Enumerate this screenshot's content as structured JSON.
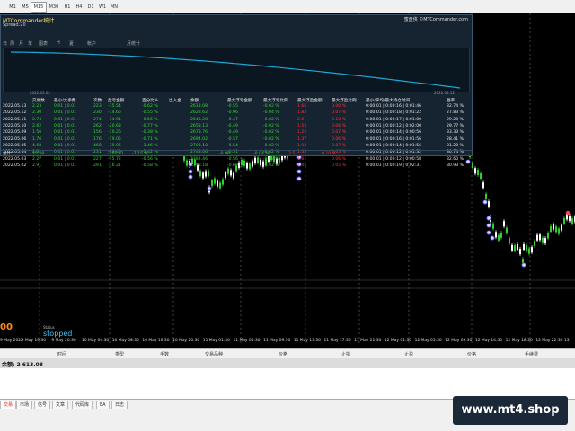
{
  "timeframes": [
    "M1",
    "M5",
    "M15",
    "M30",
    "H1",
    "H4",
    "D1",
    "W1",
    "MN"
  ],
  "active_timeframe": "M30",
  "panel": {
    "title": "MTCommander统计",
    "subtitle": "Spread:20",
    "link": "蜜盘侠 ©MTCommander.com",
    "tabs": [
      "日",
      "周",
      "月",
      "年",
      "图表",
      "H",
      "夏",
      "帐户",
      "",
      "",
      "",
      "月统计",
      "账"
    ],
    "equity_start": "2022.05.02",
    "equity_end": "2022.05.12",
    "headers": [
      "",
      "交易数",
      "最小/大手数",
      "次数",
      "盈亏金额",
      "百分比%",
      "出入金",
      "余额",
      "最大浮亏金额",
      "最大浮亏比例",
      "最大浮盈金额",
      "最大浮盈比例",
      "最小/平均/最大持仓时间",
      "胜率"
    ],
    "rows": [
      [
        "2022.05.13",
        "2.23",
        "0.01 | 0.01",
        "223",
        "-15.54",
        "-0.62 %",
        "",
        "2613.08",
        "-0.55",
        "-0.02 %",
        "1.65",
        "0.00 %",
        "0:00:01 | 0:00:16 | 0:01:46",
        "32.74 %"
      ],
      [
        "2022.05.12",
        "2.30",
        "0.01 | 0.01",
        "230",
        "-14.66",
        "-0.55 %",
        "",
        "2628.62",
        "-0.96",
        "-0.04 %",
        "1.83",
        "0.07 %",
        "0:00:01 | 0:00:18 | 0:01:22",
        "27.83 %"
      ],
      [
        "2022.05.11",
        "2.74",
        "0.01 | 0.01",
        "274",
        "-14.91",
        "-0.56 %",
        "",
        "2643.28",
        "-0.47",
        "-0.02 %",
        "2.5",
        "0.10 %",
        "0:00:01 | 0:00:17 | 0:01:00",
        "29.20 %"
      ],
      [
        "2022.05.10",
        "2.62",
        "0.01 | 0.01",
        "262",
        "-20.63",
        "-0.77 %",
        "",
        "2658.13",
        "-0.49",
        "-0.02 %",
        "1.53",
        "0.06 %",
        "0:00:01 | 0:00:12 | 0:02:00",
        "29.77 %"
      ],
      [
        "2022.05.09",
        "1.56",
        "0.01 | 0.01",
        "156",
        "-10.26",
        "-0.38 %",
        "",
        "2678.76",
        "-0.49",
        "-0.02 %",
        "1.22",
        "0.07 %",
        "0:00:01 | 0:00:14 | 0:00:56",
        "33.33 %"
      ],
      [
        "2022.05.06",
        "1.76",
        "0.01 | 0.01",
        "176",
        "-19.05",
        "-0.71 %",
        "",
        "2694.02",
        "-0.57",
        "-0.02 %",
        "1.37",
        "0.06 %",
        "0:00:01 | 0:00:16 | 0:01:56",
        "28.41 %"
      ],
      [
        "2022.05.05",
        "4.68",
        "0.01 | 0.01",
        "468",
        "-39.96",
        "-1.46 %",
        "",
        "2703.10",
        "-0.54",
        "-0.02 %",
        "1.92",
        "0.07 %",
        "0:00:01 | 0:00:14 | 0:01:56",
        "31.20 %"
      ],
      [
        "2022.05.04",
        "2.31",
        "0.01 | 0.01",
        "231",
        "-39.40",
        "-1.42 %",
        "",
        "2743.06",
        "-0.51",
        "-0.02 %",
        "1.33",
        "0.05 %",
        "0:00:01 | 0:00:12 | 0:01:32",
        "30.74 %"
      ],
      [
        "2022.05.03",
        "2.27",
        "0.01 | 0.01",
        "227",
        "-15.72",
        "-0.56 %",
        "",
        "2782.46",
        "-0.56",
        "-0.02 %",
        "1.61",
        "0.06 %",
        "0:00:01 | 0:00:12 | 0:00:58",
        "32.60 %"
      ],
      [
        "2022.05.02",
        "2.91",
        "0.01 | 0.01",
        "291",
        "-16.21",
        "-0.58 %",
        "",
        "2798.18",
        "-0.69",
        "-0.02 %",
        "1.45",
        "0.05 %",
        "0:00:01 | 0:00:19 | 0:02:31",
        "30.93 %"
      ]
    ],
    "footer": {
      "label": "总计",
      "trades": "25.58",
      "pnl": "-201.31",
      "pct": "-7.15 %",
      "dd": "-0.96",
      "ddp": "-0.04 %",
      "fp": "2.5",
      "fpp": "0.10 %"
    }
  },
  "price_big": "00",
  "status_label": "Status",
  "status_value": "stopped",
  "xaxis_ticks": [
    "9 May 2022",
    "9 May 19:30",
    "9 May 20:30",
    "10 May 04:30",
    "10 May 08:30",
    "10 May 16:30",
    "10 May 20:30",
    "11 May 01:30",
    "11 May 05:30",
    "11 May 09:30",
    "11 May 13:30",
    "11 May 17:30",
    "11 May 21:30",
    "12 May 01:30",
    "12 May 05:30",
    "12 May 09:30",
    "12 May 14:30",
    "12 May 18:30",
    "12 May 22:30",
    "13"
  ],
  "trade_headers": [
    "时间",
    "类型",
    "手数",
    "交易品种",
    "价格",
    "止损",
    "止盈",
    "价格",
    "手续费"
  ],
  "balance_line": "余额: 2 613.08",
  "bottom_tabs": [
    "交易",
    "市场",
    "信号",
    "文章",
    "代码库",
    "EA",
    "日志"
  ],
  "brand": "www.mt4.shop",
  "colors": {
    "up_candle": "#32cd32",
    "down_candle": "#ffffff",
    "equity_line": "#1fa7d6",
    "accent_orange": "#ff8c1a",
    "status_cyan": "#3ec8ff"
  }
}
